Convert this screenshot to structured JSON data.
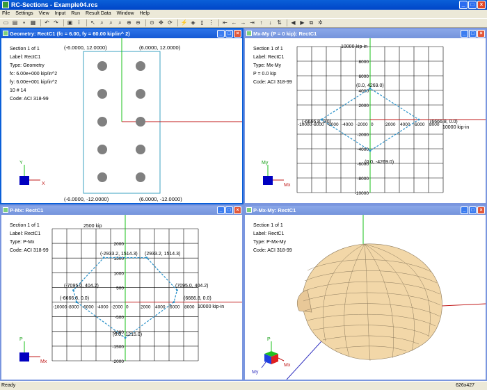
{
  "app": {
    "title": "RC-Sections - Example04.rcs"
  },
  "menu": [
    "File",
    "Settings",
    "View",
    "Input",
    "Run",
    "Result Data",
    "Window",
    "Help"
  ],
  "status": {
    "text": "Ready",
    "dims": "626x427"
  },
  "geometry": {
    "title": "Geometry: RectC1 (fc = 6.00, fy = 60.00 kip/in^ 2)",
    "info": [
      "Section 1 of 1",
      "Label: RectC1",
      "Type: Geometry",
      "fc: 6.00e+000 kip/in^2",
      "fy: 6.00e+001 kip/in^2",
      "10 # 14",
      "Code: ACI 318-99"
    ],
    "corners": {
      "tl": "(-6.0000, 12.0000)",
      "tr": "(6.0000, 12.0000)",
      "bl": "(-6.0000, -12.0000)",
      "br": "(6.0000, -12.0000)"
    },
    "axes": {
      "x": "X",
      "y": "Y"
    }
  },
  "mxmy": {
    "title": "Mx-My (P = 0 kip): RectC1",
    "info": [
      "Section 1 of 1",
      "Label: RectC1",
      "Type: Mx-My",
      "P = 0.0 kip",
      "Code: ACI 318-99"
    ],
    "y_top_label": "10000 kip-in",
    "x_right_label": "10000 kip-in",
    "points": [
      "(0.0, 4269.0)",
      "(0.0, -4269.0)",
      "(-6666.8, 0.0)",
      "(6666.8, 0.0)"
    ],
    "axes": {
      "x": "Mx",
      "y": "My"
    }
  },
  "pmx": {
    "title": "P-Mx: RectC1",
    "info": [
      "Section 1 of 1",
      "Label: RectC1",
      "Type: P-Mx",
      "Code: ACI 318-99"
    ],
    "y_top_label": "2500 kip",
    "x_right_label": "10000 kip-in",
    "points": [
      "(-2933.2, 1514.3)",
      "(2933.2, 1514.3)",
      "(-7095.0, 404.2)",
      "(7095.0, 404.2)",
      "(-6666.8, 0.0)",
      "(6666.8, 0.0)",
      "(0.0, -1215.0)"
    ],
    "axes": {
      "x": "Mx",
      "y": "P"
    }
  },
  "pmxmy": {
    "title": "P-Mx-My: RectC1",
    "info": [
      "Section 1 of 1",
      "Label: RectC1",
      "Type: P-Mx-My",
      "Code: ACI 318-99"
    ],
    "axes": {
      "x": "Mx",
      "y": "My",
      "z": "P"
    }
  },
  "chart_data": [
    {
      "type": "line",
      "title": "Mx-My (P = 0 kip): RectC1",
      "xlabel": "Mx (kip-in)",
      "ylabel": "My (kip-in)",
      "xlim": [
        -10000,
        10000
      ],
      "ylim": [
        -10000,
        10000
      ],
      "x_ticks": [
        -10000,
        -8000,
        -6000,
        -4000,
        -2000,
        0,
        2000,
        4000,
        6000,
        8000,
        10000
      ],
      "y_ticks": [
        -10000,
        -8000,
        -6000,
        -4000,
        -2000,
        0,
        2000,
        4000,
        6000,
        8000,
        10000
      ],
      "series": [
        {
          "x": [
            -6666.8,
            0,
            6666.8,
            0,
            -6666.8
          ],
          "y": [
            0,
            4269,
            0,
            -4269,
            0
          ]
        }
      ]
    },
    {
      "type": "line",
      "title": "P-Mx: RectC1",
      "xlabel": "Mx (kip-in)",
      "ylabel": "P (kip)",
      "xlim": [
        -10000,
        10000
      ],
      "ylim": [
        -2000,
        2500
      ],
      "x_ticks": [
        -10000,
        -8000,
        -6000,
        -4000,
        -2000,
        0,
        2000,
        4000,
        6000,
        8000,
        10000
      ],
      "y_ticks": [
        -2000,
        -1500,
        -1000,
        -500,
        0,
        500,
        1000,
        1500,
        2000,
        2500
      ],
      "series": [
        {
          "x": [
            -6666.8,
            -7095.0,
            -2933.2,
            2933.2,
            7095.0,
            6666.8,
            0,
            -6666.8
          ],
          "y": [
            0,
            404.2,
            1514.3,
            1514.3,
            404.2,
            0,
            -1215.0,
            0
          ]
        }
      ]
    }
  ]
}
